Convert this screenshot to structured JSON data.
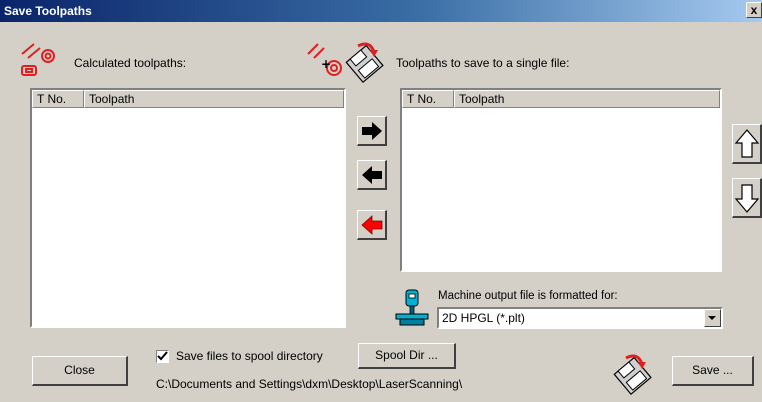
{
  "window": {
    "title": "Save Toolpaths",
    "close_glyph": "x"
  },
  "left_panel": {
    "label": "Calculated toolpaths:",
    "columns": [
      "T No.",
      "Toolpath"
    ],
    "rows": []
  },
  "right_panel": {
    "label": "Toolpaths to save to a single file:",
    "columns": [
      "T No.",
      "Toolpath"
    ],
    "rows": []
  },
  "transfer_buttons": [
    {
      "name": "add-arrow-icon",
      "color": "#000000"
    },
    {
      "name": "remove-arrow-icon",
      "color": "#000000"
    },
    {
      "name": "remove-all-arrow-icon",
      "color": "#ff0000"
    }
  ],
  "machine": {
    "label": "Machine output file is formatted for:",
    "selected_format": "2D HPGL (*.plt)"
  },
  "footer": {
    "close_label": "Close",
    "spool_checkbox_label": "Save files to spool directory",
    "spool_checked": true,
    "spool_dir_label": "Spool Dir ...",
    "spool_path": "C:\\Documents and Settings\\dxm\\Desktop\\LaserScanning\\",
    "save_label": "Save ..."
  },
  "icons": [
    "toolpaths-icon",
    "add-toolpath-icon",
    "save-disk-icon",
    "machine-icon",
    "move-up-icon",
    "move-down-icon"
  ]
}
